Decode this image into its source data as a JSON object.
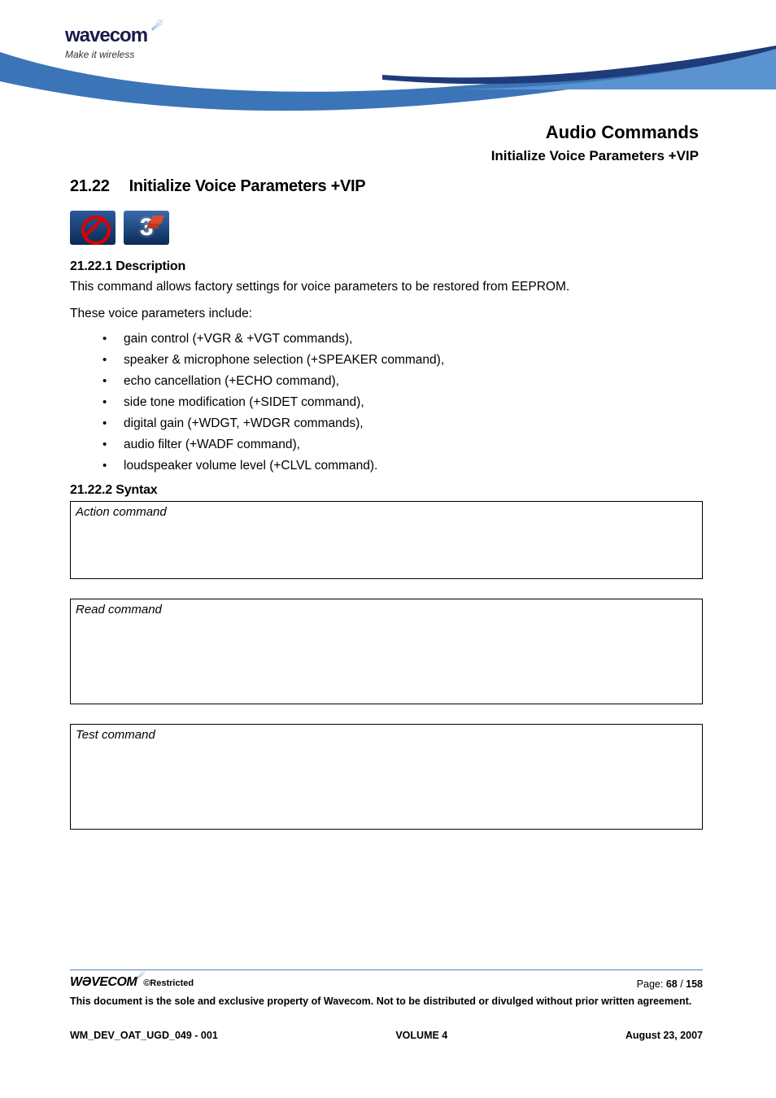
{
  "logo": {
    "brand": "wavecom",
    "tagline": "Make it wireless"
  },
  "title": {
    "main": "Audio Commands",
    "sub": "Initialize Voice Parameters +VIP"
  },
  "section": {
    "number": "21.22",
    "title": "Initialize Voice Parameters +VIP"
  },
  "icons": {
    "three": "3"
  },
  "description": {
    "heading": "21.22.1 Description",
    "para1": "This command allows factory settings for voice parameters to be restored from EEPROM.",
    "para2": "These voice parameters include:",
    "bullets": [
      "gain control (+VGR & +VGT commands),",
      "speaker & microphone selection (+SPEAKER command),",
      "echo cancellation (+ECHO command),",
      "side tone modification (+SIDET command),",
      "digital gain (+WDGT, +WDGR commands),",
      "audio filter (+WADF command),",
      "loudspeaker volume level (+CLVL command)."
    ]
  },
  "syntax": {
    "heading": "21.22.2 Syntax",
    "action_label": "Action command",
    "read_label": "Read command",
    "test_label": "Test command"
  },
  "footer": {
    "brand": "WƏVECOM",
    "restricted": "©Restricted",
    "page_label": "Page: ",
    "page_current": "68",
    "page_sep": " / ",
    "page_total": "158",
    "disclaimer": "This document is the sole and exclusive property of Wavecom. Not to be distributed or divulged without prior written agreement.",
    "doc_id": "WM_DEV_OAT_UGD_049 - 001",
    "volume": "VOLUME 4",
    "date": "August 23, 2007"
  }
}
